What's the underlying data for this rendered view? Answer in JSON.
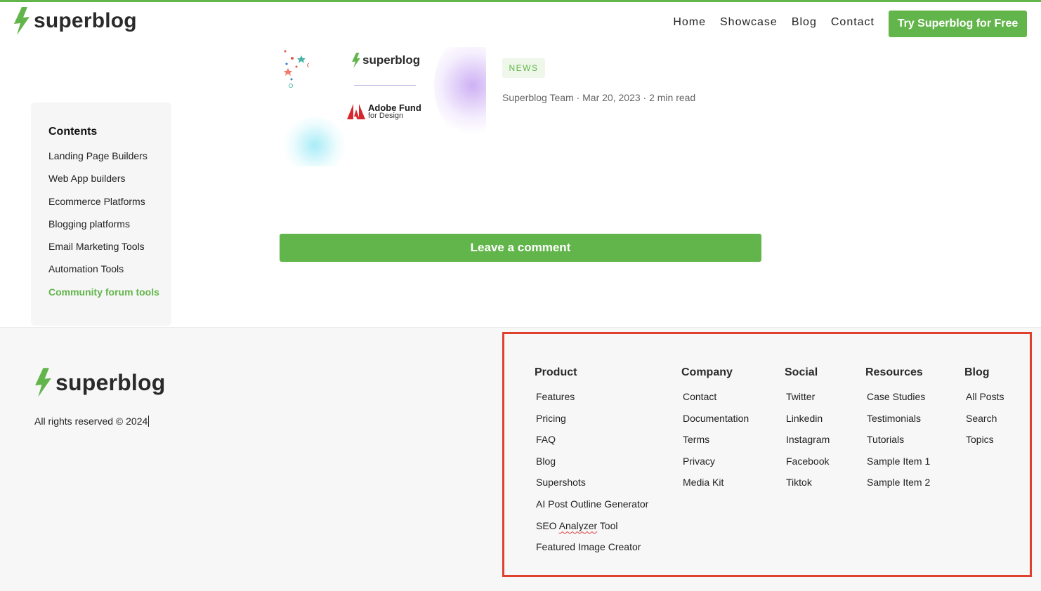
{
  "header": {
    "brand": "superblog",
    "nav": [
      "Home",
      "Showcase",
      "Blog",
      "Contact"
    ],
    "cta": "Try Superblog for Free"
  },
  "post": {
    "image_brand": "superblog",
    "image_partner_line1": "Adobe Fund",
    "image_partner_line2": "for Design",
    "tag": "NEWS",
    "meta": "Superblog Team · Mar 20, 2023 · 2 min read"
  },
  "contents": {
    "title": "Contents",
    "items": [
      "Landing Page Builders",
      "Web App builders",
      "Ecommerce Platforms",
      "Blogging platforms",
      "Email Marketing Tools",
      "Automation Tools",
      "Community forum tools"
    ],
    "active_index": 6
  },
  "comment_button": "Leave a comment",
  "footer": {
    "brand": "superblog",
    "rights": "All rights reserved © 2024",
    "columns": [
      {
        "title": "Product",
        "links": [
          "Features",
          "Pricing",
          "FAQ",
          "Blog",
          "Supershots",
          "AI Post Outline Generator",
          "SEO Analyzer Tool",
          "Featured Image Creator"
        ]
      },
      {
        "title": "Company",
        "links": [
          "Contact",
          "Documentation",
          "Terms",
          "Privacy",
          "Media Kit"
        ]
      },
      {
        "title": "Social",
        "links": [
          "Twitter",
          "Linkedin",
          "Instagram",
          "Facebook",
          "Tiktok"
        ]
      },
      {
        "title": "Resources",
        "links": [
          "Case Studies",
          "Testimonials",
          "Tutorials",
          "Sample Item 1",
          "Sample Item 2"
        ]
      },
      {
        "title": "Blog",
        "links": [
          "All Posts",
          "Search",
          "Topics"
        ]
      }
    ]
  },
  "colors": {
    "brand_green": "#62b54a",
    "highlight_red": "#e0412e"
  }
}
